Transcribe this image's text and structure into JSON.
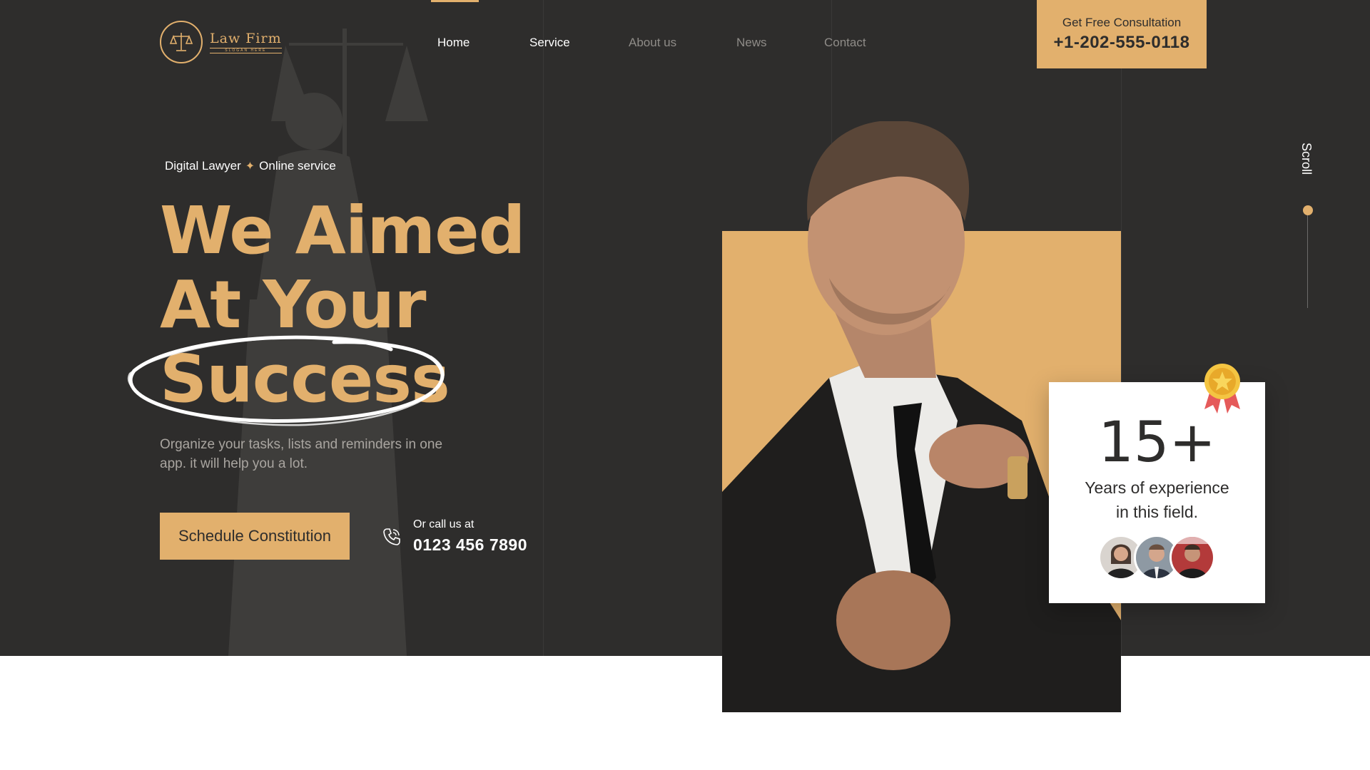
{
  "brand": {
    "name": "Law Firm",
    "slogan": "SLOGAN HERE"
  },
  "nav": {
    "items": [
      {
        "label": "Home"
      },
      {
        "label": "Service"
      },
      {
        "label": "About us"
      },
      {
        "label": "News"
      },
      {
        "label": "Contact"
      }
    ]
  },
  "consultation": {
    "label": "Get Free Consultation",
    "phone": "+1-202-555-0118"
  },
  "hero": {
    "tagline_left": "Digital Lawyer",
    "tagline_right": "Online service",
    "headline": [
      "We Aimed",
      "At Your",
      "Success"
    ],
    "description": "Organize your tasks, lists and reminders in one app. it will help you a lot.",
    "cta_label": "Schedule  Constitution",
    "call_label": "Or call us at",
    "call_phone": "0123 456 7890"
  },
  "experience": {
    "number": "15+",
    "text_line1": "Years of experience",
    "text_line2": "in this field."
  },
  "scroll": {
    "label": "Scroll"
  },
  "colors": {
    "background": "#2e2d2c",
    "accent": "#e2b06d",
    "card": "#ffffff"
  },
  "icons": [
    "scales-logo-icon",
    "sparkle-icon",
    "phone-icon",
    "medal-icon"
  ]
}
